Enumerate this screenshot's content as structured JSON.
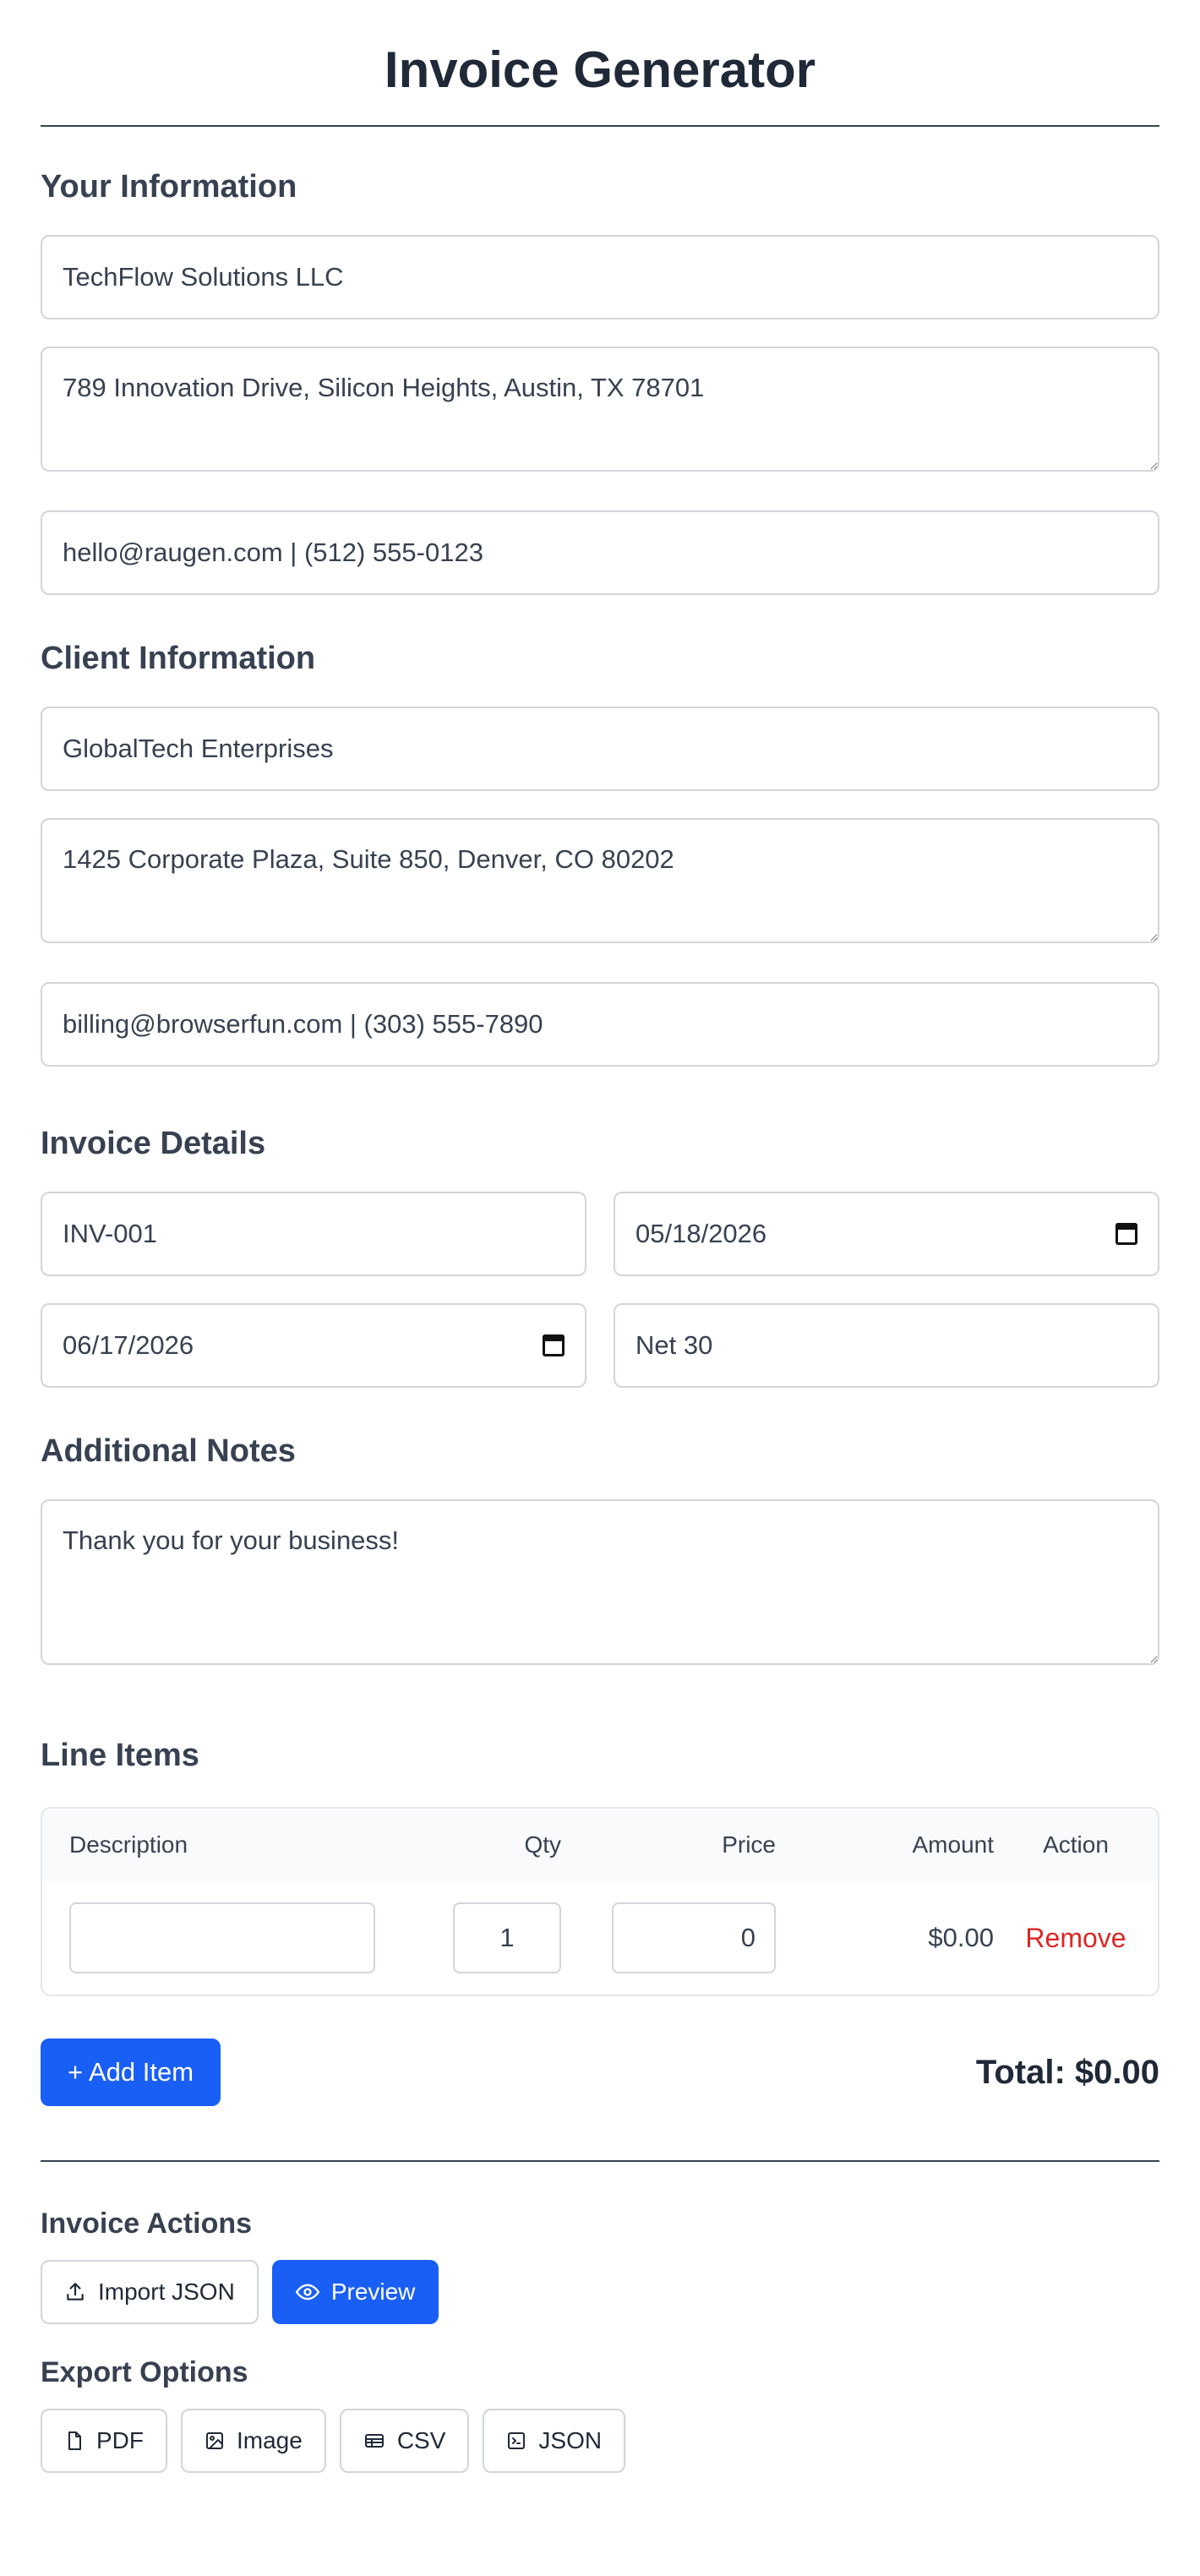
{
  "title": "Invoice Generator",
  "your_info": {
    "heading": "Your Information",
    "name": "TechFlow Solutions LLC",
    "address": "789 Innovation Drive, Silicon Heights, Austin, TX 78701",
    "contact": "hello@raugen.com | (512) 555-0123"
  },
  "client_info": {
    "heading": "Client Information",
    "name": "GlobalTech Enterprises",
    "address": "1425 Corporate Plaza, Suite 850, Denver, CO 80202",
    "contact": "billing@browserfun.com | (303) 555-7890"
  },
  "invoice_details": {
    "heading": "Invoice Details",
    "number": "INV-001",
    "date": "05/18/2026",
    "due_date": "06/17/2026",
    "terms": "Net 30"
  },
  "notes": {
    "heading": "Additional Notes",
    "text": "Thank you for your business!"
  },
  "line_items": {
    "heading": "Line Items",
    "columns": {
      "description": "Description",
      "qty": "Qty",
      "price": "Price",
      "amount": "Amount",
      "action": "Action"
    },
    "rows": [
      {
        "description": "",
        "qty": "1",
        "price": "0",
        "amount": "$0.00",
        "action": "Remove"
      }
    ],
    "add_label": "+ Add Item",
    "total": "Total: $0.00"
  },
  "actions": {
    "heading": "Invoice Actions",
    "import_label": "Import JSON",
    "preview_label": "Preview"
  },
  "export": {
    "heading": "Export Options",
    "pdf": "PDF",
    "image": "Image",
    "csv": "CSV",
    "json": "JSON"
  },
  "colors": {
    "primary": "#1a5ff5",
    "danger": "#dc2626",
    "text": "#1f2937"
  }
}
